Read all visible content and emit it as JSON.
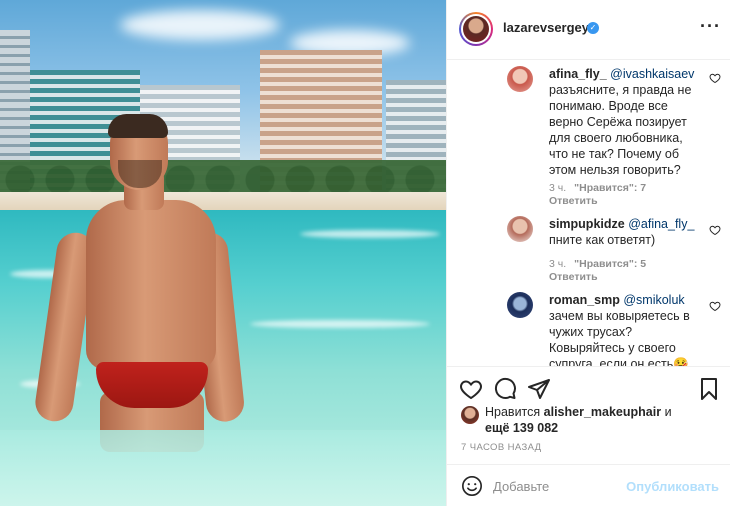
{
  "header": {
    "username": "lazarevsergey",
    "verified_icon": "verified-badge-icon",
    "more_icon": "more-dots-icon"
  },
  "comments": [
    {
      "username": "afina_fly_",
      "mention": "@ivashkaisaev",
      "text": "разъясните, я правда не понимаю. Вроде все верно Серёжа позирует для своего любовника, что не так? Почему об этом нельзя говорить?",
      "time": "3 ч.",
      "likes": "\"Нравится\": 7",
      "reply": "Ответить"
    },
    {
      "username": "simpupkidze",
      "mention": "@afina_fly_",
      "text": "пните как ответят)",
      "time": "3 ч.",
      "likes": "\"Нравится\": 5",
      "reply": "Ответить"
    },
    {
      "username": "roman_smp",
      "mention": "@smikoluk",
      "text": "зачем вы ковыряетесь в чужих трусах? Ковыряйтесь у своего супруга, если он есть🤒"
    }
  ],
  "actions": {
    "like_icon": "heart-icon",
    "comment_icon": "comment-icon",
    "share_icon": "share-icon",
    "save_icon": "bookmark-icon"
  },
  "likes": {
    "prefix": "Нравится",
    "user": "alisher_makeuphair",
    "middle": "и",
    "count_text": "ещё 139 082"
  },
  "timestamp": "7 ЧАСОВ НАЗАД",
  "add_comment": {
    "placeholder": "Добавьте",
    "publish_label": "Опубликовать",
    "emoji_icon": "smiley-icon"
  },
  "colors": {
    "link": "#00376b",
    "verified": "#3897f0",
    "muted": "#8e8e8e",
    "publish_disabled": "#b2dffc"
  }
}
